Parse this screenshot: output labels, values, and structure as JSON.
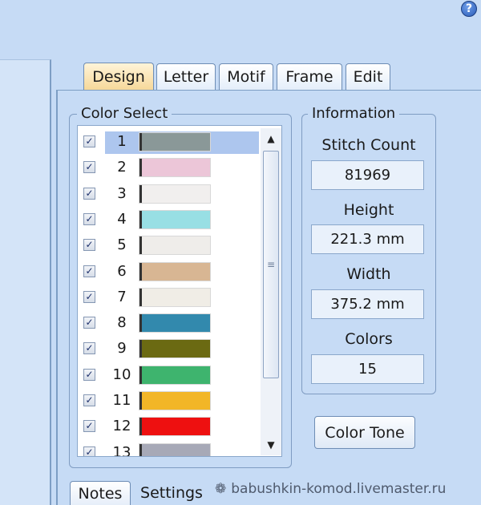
{
  "tabs": [
    {
      "label": "Design",
      "active": true
    },
    {
      "label": "Letter",
      "active": false
    },
    {
      "label": "Motif",
      "active": false
    },
    {
      "label": "Frame",
      "active": false
    },
    {
      "label": "Edit",
      "active": false
    }
  ],
  "color_select": {
    "title": "Color Select",
    "items": [
      {
        "number": "1",
        "color": "#8a9898",
        "checked": true,
        "selected": true
      },
      {
        "number": "2",
        "color": "#ecc6d8",
        "checked": true
      },
      {
        "number": "3",
        "color": "#f1efee",
        "checked": true
      },
      {
        "number": "4",
        "color": "#98dfe4",
        "checked": true
      },
      {
        "number": "5",
        "color": "#efedea",
        "checked": true
      },
      {
        "number": "6",
        "color": "#d8b693",
        "checked": true
      },
      {
        "number": "7",
        "color": "#f0ede6",
        "checked": true
      },
      {
        "number": "8",
        "color": "#3289ad",
        "checked": true
      },
      {
        "number": "9",
        "color": "#6b6a12",
        "checked": true
      },
      {
        "number": "10",
        "color": "#3eb46e",
        "checked": true
      },
      {
        "number": "11",
        "color": "#f2b627",
        "checked": true
      },
      {
        "number": "12",
        "color": "#ee1010",
        "checked": true
      },
      {
        "number": "13",
        "color": "#a7a9b7",
        "checked": true
      }
    ]
  },
  "information": {
    "title": "Information",
    "stitch_count_label": "Stitch Count",
    "stitch_count": "81969",
    "height_label": "Height",
    "height": "221.3 mm",
    "width_label": "Width",
    "width": "375.2 mm",
    "colors_label": "Colors",
    "colors": "15"
  },
  "color_tone_button": "Color Tone",
  "bottom_tabs": [
    {
      "label": "Notes",
      "active": true
    },
    {
      "label": "Settings",
      "active": false
    }
  ],
  "watermark": "babushkin-komod.livemaster.ru",
  "icons": {
    "help": "help-icon",
    "check": "checkmark-icon",
    "scroll_up": "arrow-up-icon",
    "scroll_down": "arrow-down-icon"
  },
  "help_glyph": "?",
  "check_glyph": "✓",
  "scroll_up_glyph": "▲",
  "scroll_down_glyph": "▼",
  "grip_glyph": "≡",
  "flower_glyph": "❁"
}
